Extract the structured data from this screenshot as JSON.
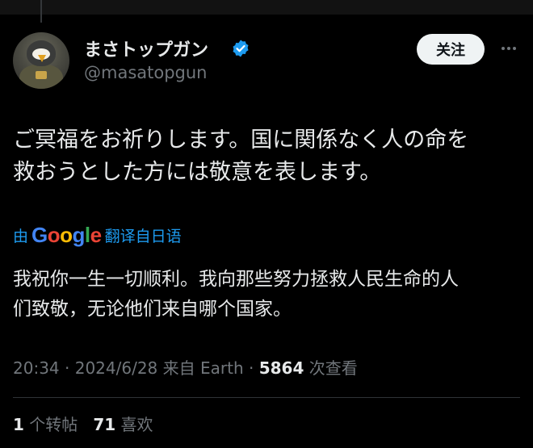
{
  "author": {
    "display_name": "まさトップガン",
    "handle": "@masatopgun",
    "verified_icon": "verified-badge-icon",
    "avatar_icon": "penguin-pilot-avatar"
  },
  "actions": {
    "follow_label": "关注",
    "more_icon": "more-horizontal-icon"
  },
  "tweet": {
    "text_line1": "ご冥福をお祈りします。国に関係なく人の命を",
    "text_line2": "救おうとした方には敬意を表します。"
  },
  "translation": {
    "by_label": "由",
    "google_logo": [
      "G",
      "o",
      "o",
      "g",
      "l",
      "e"
    ],
    "google_colors": [
      "#4285F4",
      "#EA4335",
      "#FBBC05",
      "#4285F4",
      "#34A853",
      "#EA4335"
    ],
    "from_label": "翻译自日语",
    "text_line1": "我祝你一生一切顺利。我向那些努力拯救人民生命的人",
    "text_line2": "们致敬，无论他们来自哪个国家。"
  },
  "meta": {
    "time": "20:34",
    "sep1": " · ",
    "date": "2024/6/28",
    "source": " 来自 Earth",
    "sep2": " · ",
    "views_count": "5864",
    "views_label": " 次查看"
  },
  "stats": {
    "retweets_count": "1",
    "retweets_label": "个转帖",
    "likes_count": "71",
    "likes_label": " 喜欢"
  },
  "colors": {
    "background": "#000000",
    "text_primary": "#e7e9ea",
    "text_secondary": "#71767b",
    "accent": "#1d9bf0"
  }
}
